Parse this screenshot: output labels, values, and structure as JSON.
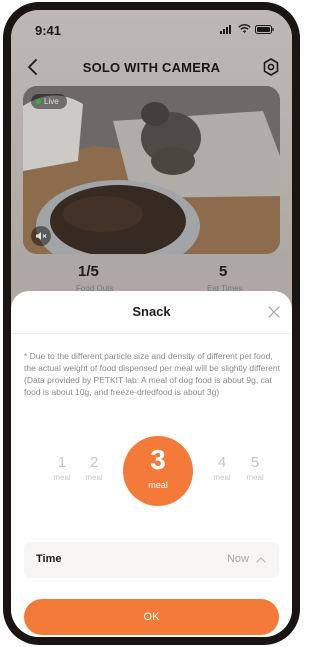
{
  "status": {
    "time": "9:41",
    "signal_icon": "signal-icon",
    "wifi_icon": "wifi-icon",
    "battery_icon": "battery-icon"
  },
  "header": {
    "title": "SOLO WITH CAMERA",
    "back_icon": "chevron-left-icon",
    "settings_icon": "settings-icon"
  },
  "camera": {
    "live_label": "Live",
    "mute_icon": "speaker-muted-icon"
  },
  "stats": [
    {
      "value": "1/5",
      "label": "Food Outs"
    },
    {
      "value": "5",
      "label": "Eat Times"
    }
  ],
  "sheet": {
    "title": "Snack",
    "close_icon": "close-icon",
    "note": "* Due to the different particle size and density of different pet food, the actual weight of food dispensed per meal will be slightly different (Data provided by PETKIT lab: A meal of dog food is about 9g, cat food is about 10g, and freeze-driedfood is about 3g)",
    "meals": [
      {
        "num": "1",
        "label": "meal"
      },
      {
        "num": "2",
        "label": "meal"
      },
      {
        "num": "3",
        "label": "meal",
        "selected": true
      },
      {
        "num": "4",
        "label": "meal"
      },
      {
        "num": "5",
        "label": "meal"
      }
    ],
    "time_label": "Time",
    "time_value": "Now",
    "ok_label": "OK"
  },
  "colors": {
    "accent": "#f47a3a",
    "frame": "#1a1413"
  }
}
